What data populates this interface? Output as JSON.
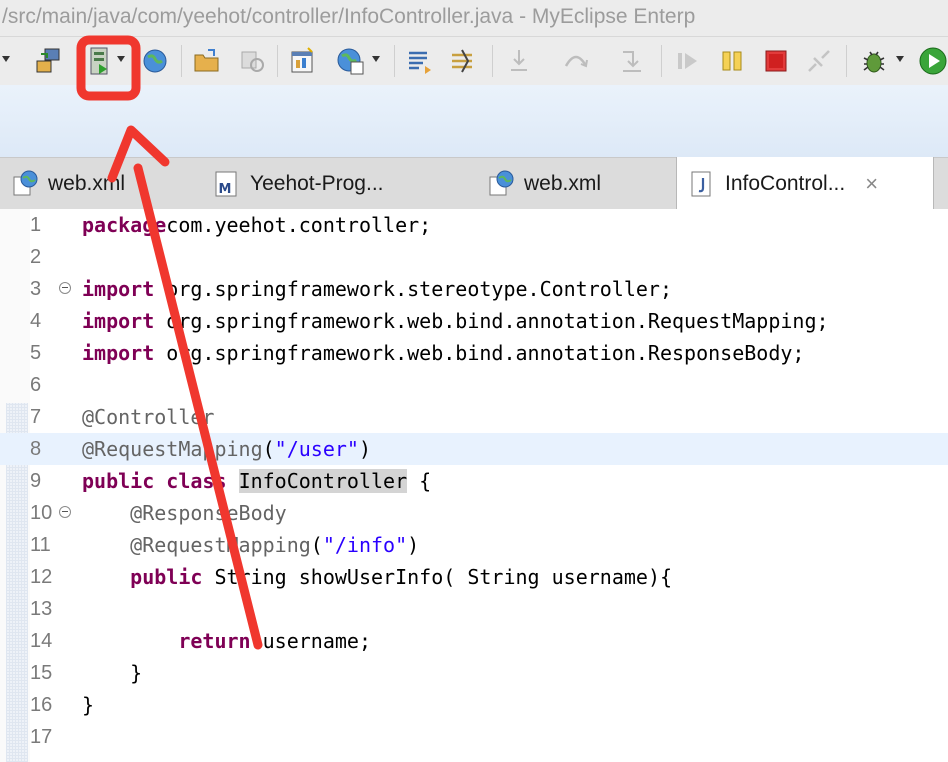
{
  "window": {
    "title": "/src/main/java/com/yeehot/controller/InfoController.java - MyEclipse Enterp"
  },
  "toolbar": {
    "buttons": [
      {
        "icon": "deploy-icon",
        "dropdown": false
      },
      {
        "icon": "server-run-icon",
        "dropdown": true
      },
      {
        "icon": "globe-icon",
        "dropdown": false
      },
      {
        "icon": "open-folder-icon",
        "dropdown": false
      },
      {
        "icon": "refresh-disabled-icon",
        "dropdown": false
      },
      {
        "icon": "new-window-icon",
        "dropdown": false
      },
      {
        "icon": "web-browser-icon",
        "dropdown": true
      },
      {
        "icon": "list-icon",
        "dropdown": false
      },
      {
        "icon": "step-icon",
        "dropdown": false
      },
      {
        "icon": "step-into-icon",
        "dropdown": false
      },
      {
        "icon": "step-over-icon",
        "dropdown": false
      },
      {
        "icon": "step-return-icon",
        "dropdown": false
      },
      {
        "icon": "resume-icon",
        "dropdown": false
      },
      {
        "icon": "pause-icon",
        "dropdown": false
      },
      {
        "icon": "stop-icon",
        "dropdown": false
      },
      {
        "icon": "disconnect-icon",
        "dropdown": false
      },
      {
        "icon": "debug-bug-icon",
        "dropdown": true
      },
      {
        "icon": "run-icon",
        "dropdown": false
      }
    ],
    "highlight_color": "#f0372e"
  },
  "tabs": [
    {
      "label": "web.xml",
      "icon": "web-xml-icon",
      "active": false
    },
    {
      "label": "Yeehot-Prog...",
      "icon": "maven-pom-icon",
      "active": false
    },
    {
      "label": "web.xml",
      "icon": "web-xml-icon",
      "active": false
    },
    {
      "label": "InfoControl...",
      "icon": "java-file-icon",
      "active": true,
      "close": "×"
    }
  ],
  "editor": {
    "lines": [
      {
        "n": "1",
        "tokens": [
          [
            "kw",
            "package"
          ],
          [
            "",
            "com.yeehot.controller;"
          ]
        ]
      },
      {
        "n": "2",
        "tokens": []
      },
      {
        "n": "3",
        "fold": true,
        "tokens": [
          [
            "kw",
            "import"
          ],
          [
            "",
            " org.springframework.stereotype.Controller;"
          ]
        ]
      },
      {
        "n": "4",
        "tokens": [
          [
            "kw",
            "import"
          ],
          [
            "",
            " org.springframework.web.bind.annotation.RequestMapping;"
          ]
        ]
      },
      {
        "n": "5",
        "tokens": [
          [
            "kw",
            "import"
          ],
          [
            "",
            " org.springframework.web.bind.annotation.ResponseBody;"
          ]
        ]
      },
      {
        "n": "6",
        "tokens": []
      },
      {
        "n": "7",
        "tokens": [
          [
            "ann",
            "@Controller"
          ]
        ]
      },
      {
        "n": "8",
        "current": true,
        "tokens": [
          [
            "ann",
            "@RequestMapping"
          ],
          [
            "",
            "("
          ],
          [
            "str",
            "\"/user\""
          ],
          [
            "",
            ")"
          ]
        ]
      },
      {
        "n": "9",
        "tokens": [
          [
            "kw",
            "public"
          ],
          [
            "",
            " "
          ],
          [
            "kw",
            "class"
          ],
          [
            "",
            " "
          ],
          [
            "hl",
            "InfoController"
          ],
          [
            "",
            " {"
          ]
        ]
      },
      {
        "n": "10",
        "fold": true,
        "tokens": [
          [
            "",
            "    "
          ],
          [
            "ann",
            "@ResponseBody"
          ]
        ]
      },
      {
        "n": "11",
        "tokens": [
          [
            "",
            "    "
          ],
          [
            "ann",
            "@RequestMapping"
          ],
          [
            "",
            "("
          ],
          [
            "str",
            "\"/info\""
          ],
          [
            "",
            ")"
          ]
        ]
      },
      {
        "n": "12",
        "tokens": [
          [
            "",
            "    "
          ],
          [
            "kw",
            "public"
          ],
          [
            "",
            " String showUserInfo( String username){"
          ]
        ]
      },
      {
        "n": "13",
        "tokens": []
      },
      {
        "n": "14",
        "tokens": [
          [
            "",
            "        "
          ],
          [
            "kw",
            "return"
          ],
          [
            "",
            " username;"
          ]
        ]
      },
      {
        "n": "15",
        "tokens": [
          [
            "",
            "    }"
          ]
        ]
      },
      {
        "n": "16",
        "tokens": [
          [
            "",
            "}"
          ]
        ]
      },
      {
        "n": "17",
        "tokens": []
      }
    ]
  }
}
